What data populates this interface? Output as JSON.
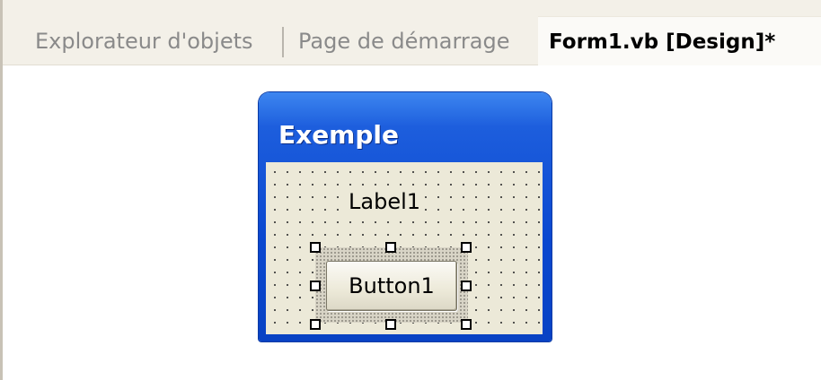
{
  "tabs": {
    "object_browser": "Explorateur d'objets",
    "start_page": "Page de démarrage",
    "active": "Form1.vb [Design]*"
  },
  "form": {
    "title": "Exemple",
    "label": "Label1",
    "button": "Button1"
  },
  "colors": {
    "titlebar_blue": "#0a47cf",
    "form_client": "#ece9d8",
    "tabstrip": "#f3f0e8"
  }
}
